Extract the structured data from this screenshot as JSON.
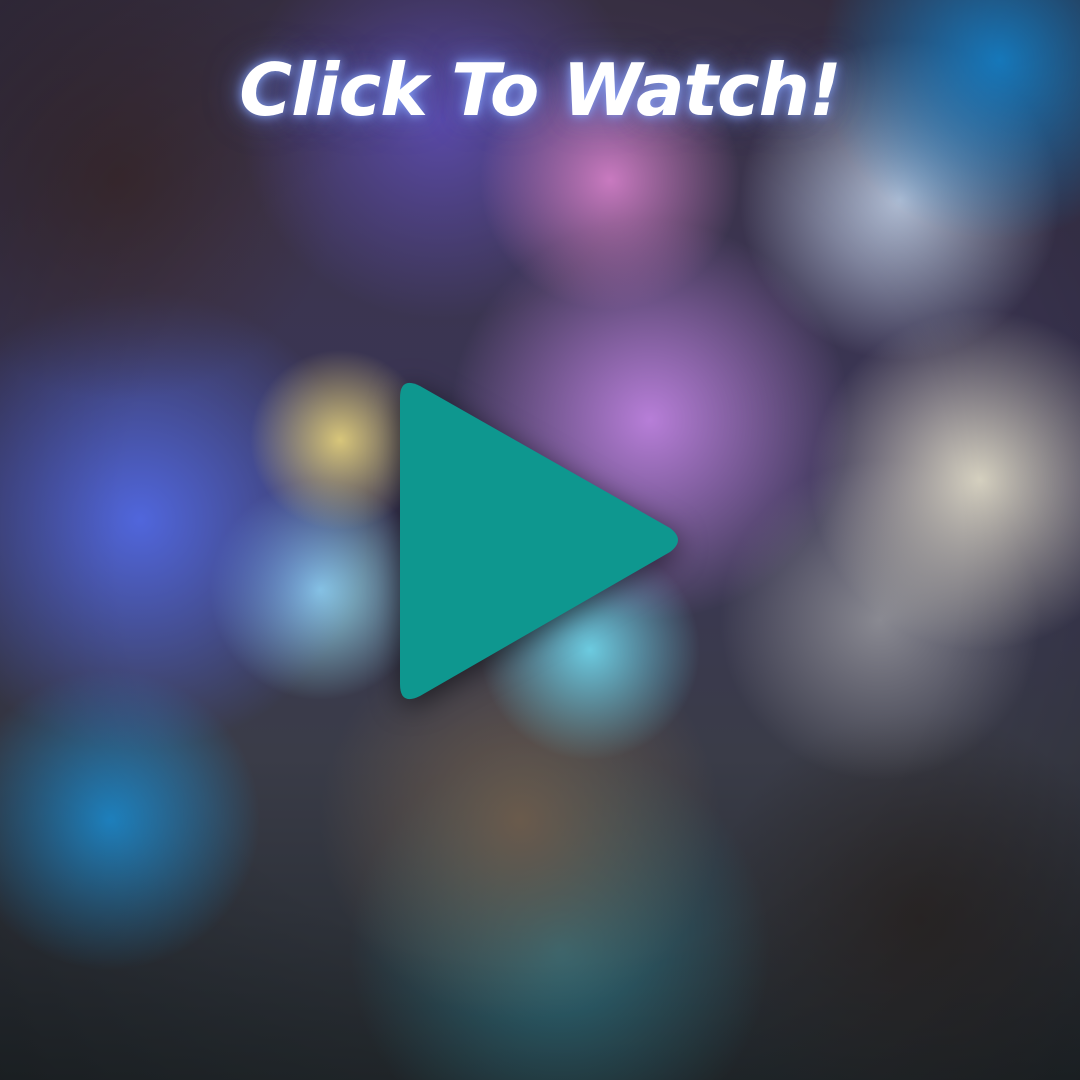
{
  "headline": {
    "text": "Click To Watch!"
  },
  "play_button": {
    "icon": "play-icon",
    "color": "#0e978f"
  },
  "colors": {
    "headline_text": "#ffffff",
    "headline_glow": "#8caaff",
    "play_accent": "#0e978f"
  }
}
